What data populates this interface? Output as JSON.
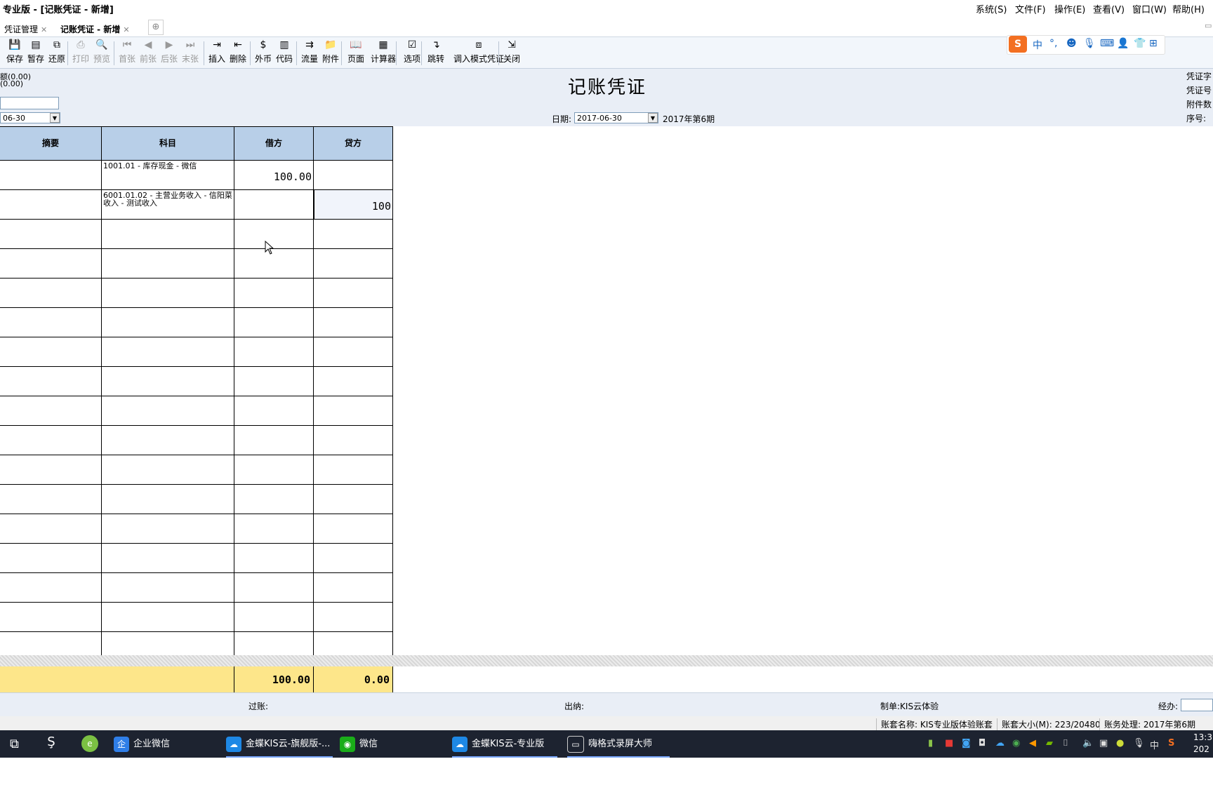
{
  "window": {
    "title": "专业版 - [记账凭证 - 新增]",
    "menu": [
      "系统(S)",
      "文件(F)",
      "操作(E)",
      "查看(V)",
      "窗口(W)",
      "帮助(H)"
    ]
  },
  "tabs": [
    {
      "label": "凭证管理",
      "active": false
    },
    {
      "label": "记账凭证 - 新增",
      "active": true
    }
  ],
  "toolbar": {
    "buttons": [
      {
        "label": "保存",
        "icon": "save-icon",
        "enabled": true
      },
      {
        "label": "暂存",
        "icon": "draft-icon",
        "enabled": true
      },
      {
        "label": "还原",
        "icon": "restore-icon",
        "enabled": true
      },
      {
        "label": "打印",
        "icon": "print-icon",
        "enabled": false
      },
      {
        "label": "预览",
        "icon": "preview-icon",
        "enabled": false
      },
      {
        "label": "首张",
        "icon": "first-icon",
        "enabled": false
      },
      {
        "label": "前张",
        "icon": "prev-icon",
        "enabled": false
      },
      {
        "label": "后张",
        "icon": "next-icon",
        "enabled": false
      },
      {
        "label": "末张",
        "icon": "last-icon",
        "enabled": false
      },
      {
        "label": "插入",
        "icon": "insert-row-icon",
        "enabled": true
      },
      {
        "label": "删除",
        "icon": "delete-row-icon",
        "enabled": true
      },
      {
        "label": "外币",
        "icon": "currency-icon",
        "enabled": true
      },
      {
        "label": "代码",
        "icon": "code-icon",
        "enabled": true
      },
      {
        "label": "流量",
        "icon": "cashflow-icon",
        "enabled": true
      },
      {
        "label": "附件",
        "icon": "folder-icon",
        "enabled": true
      },
      {
        "label": "页面",
        "icon": "book-icon",
        "enabled": true
      },
      {
        "label": "计算器",
        "icon": "calculator-icon",
        "enabled": true
      },
      {
        "label": "选项",
        "icon": "options-icon",
        "enabled": true
      },
      {
        "label": "跳转",
        "icon": "jump-icon",
        "enabled": true
      },
      {
        "label": "调入模式凭证",
        "icon": "template-icon",
        "enabled": true
      },
      {
        "label": "关闭",
        "icon": "exit-icon",
        "enabled": true
      }
    ]
  },
  "header": {
    "left_line1": "额(0.00)",
    "left_line2": "(0.00)",
    "left_date": "06-30",
    "title": "记账凭证",
    "date_label": "日期:",
    "date_value": "2017-06-30",
    "period": "2017年第6期",
    "right_labels": [
      "凭证字",
      "凭证号",
      "附件数",
      "序号:"
    ]
  },
  "grid": {
    "columns": [
      "摘要",
      "科目",
      "借方",
      "贷方"
    ],
    "rows": [
      {
        "summary": "",
        "account": "1001.01 - 库存现金 - 微信",
        "debit": "100.00",
        "credit": ""
      },
      {
        "summary": "",
        "account": "6001.01.02 - 主营业务收入 - 信阳菜收入 - 测试收入",
        "debit": "",
        "credit": "100"
      }
    ],
    "empty_rows": 15,
    "totals": {
      "debit": "100.00",
      "credit": "0.00"
    }
  },
  "footer": {
    "posted_label": "过账:",
    "cashier_label": "出纳:",
    "maker_label": "制单:KIS云体验",
    "handler_label": "经办:"
  },
  "statusbar": {
    "account_name": "账套名称: KIS专业版体验账套",
    "account_size": "账套大小(M): 223/20480",
    "processing": "账务处理: 2017年第6期"
  },
  "taskbar": {
    "items": [
      {
        "label": "企业微信",
        "open": false
      },
      {
        "label": "金蝶KIS云-旗舰版-...",
        "open": true
      },
      {
        "label": "微信",
        "open": false
      },
      {
        "label": "金蝶KIS云-专业版 -...",
        "open": true
      },
      {
        "label": "嗨格式录屏大师",
        "open": true
      }
    ],
    "ime_lang": "中",
    "clock_time": "13:3",
    "clock_date": "202"
  },
  "colors": {
    "header_bg": "#b8cfe8",
    "totals_bg": "#fde68a",
    "panel_bg": "#e9eef6",
    "taskbar_bg": "#1d2330"
  }
}
